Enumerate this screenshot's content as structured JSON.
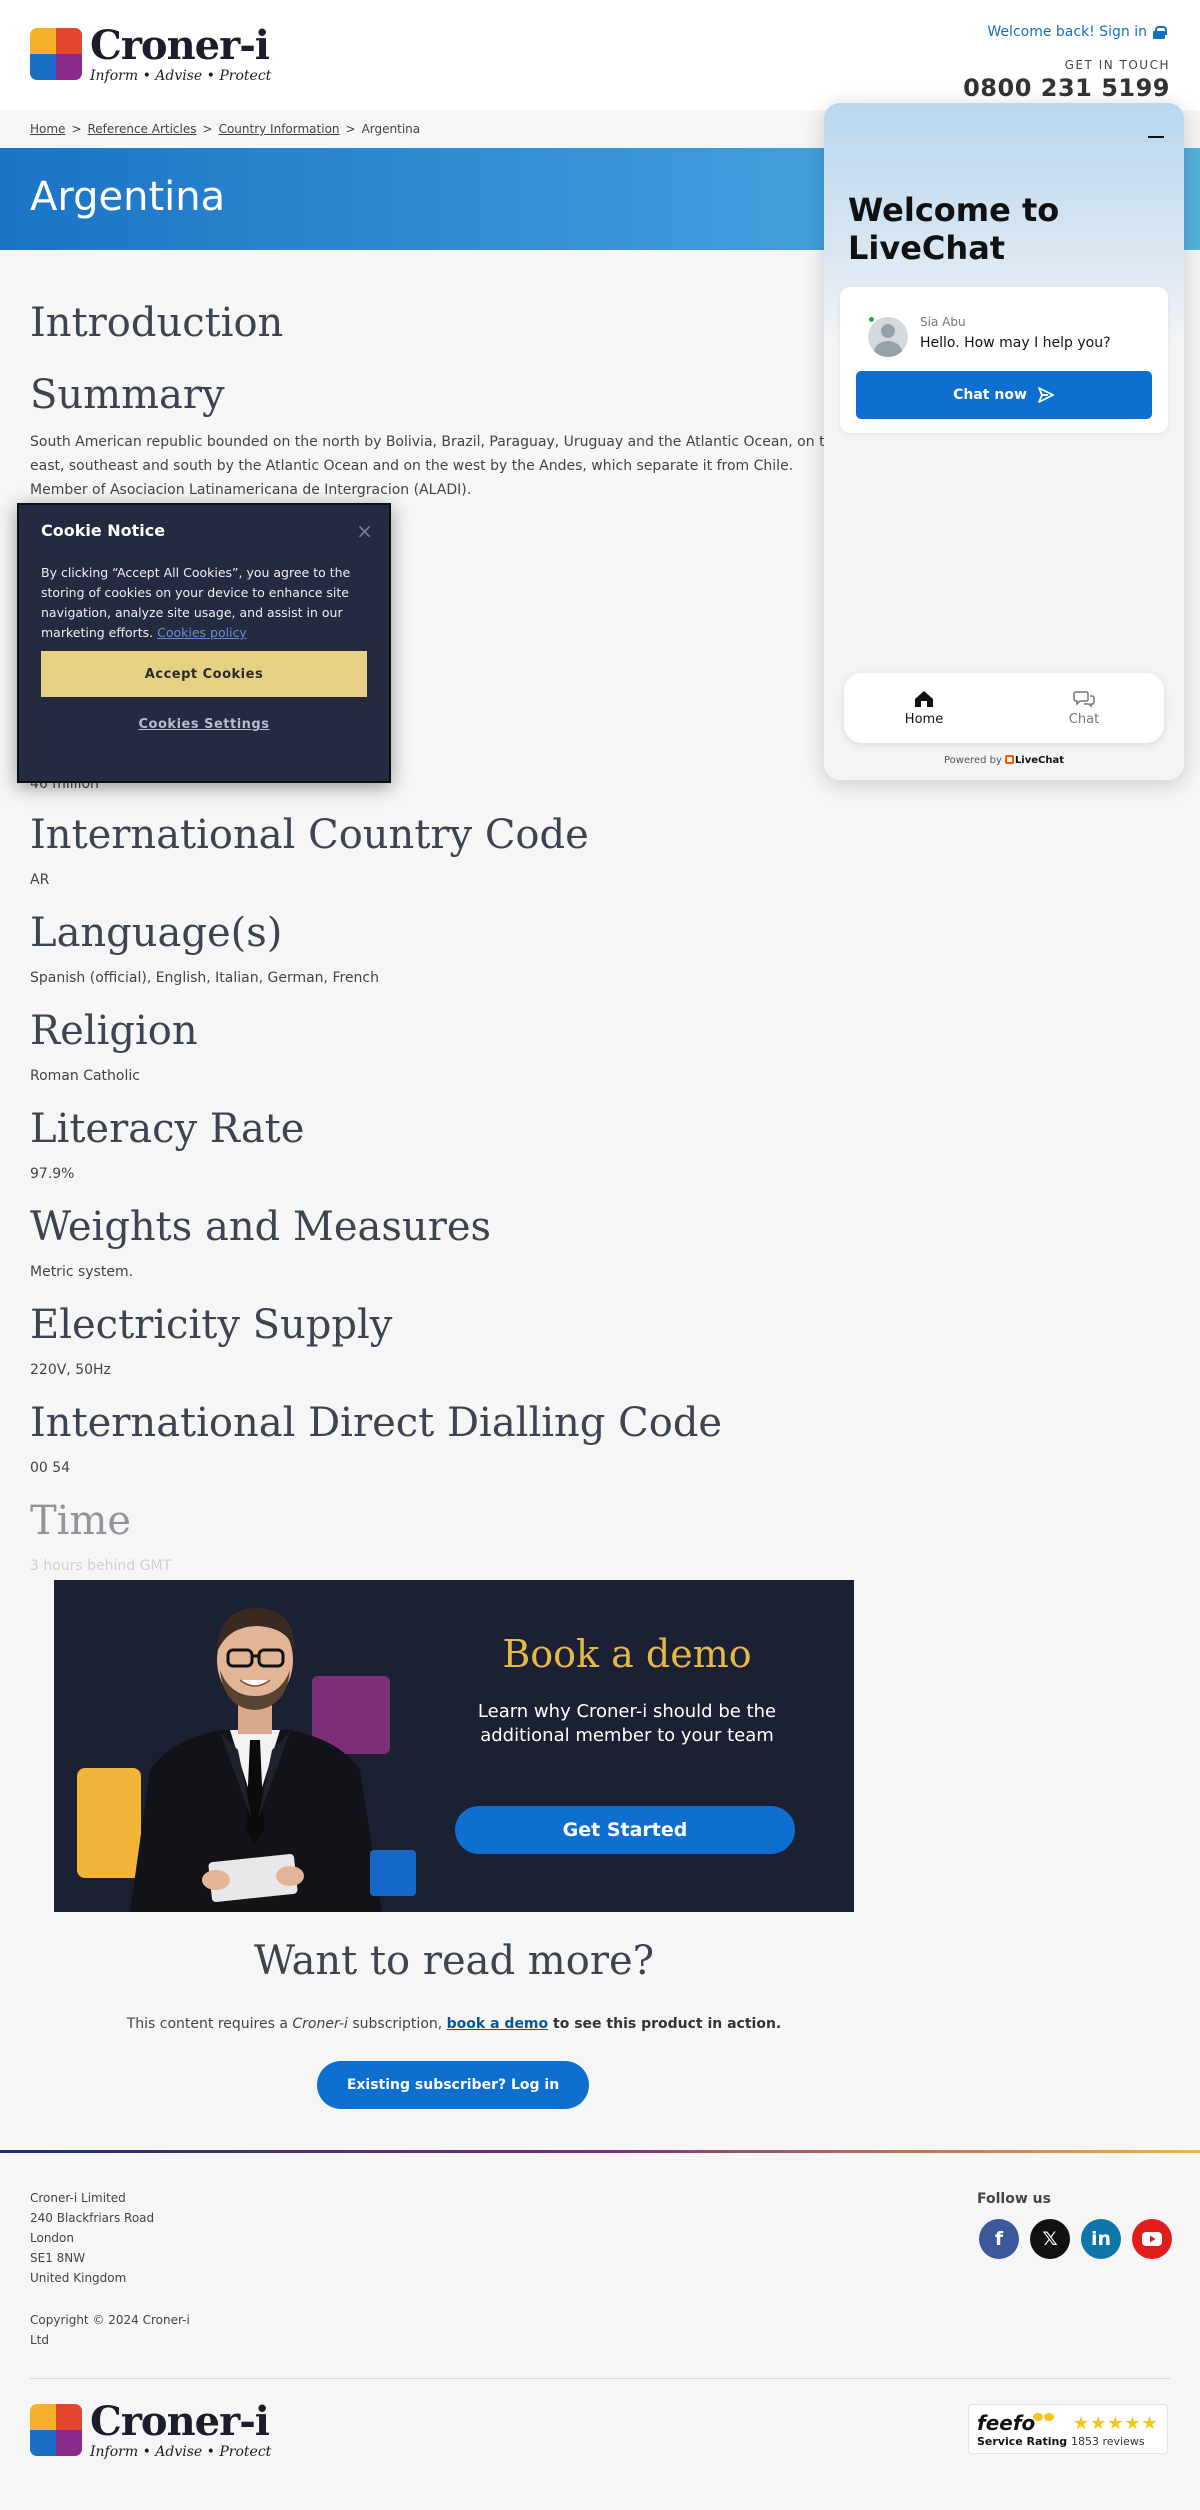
{
  "header": {
    "logo_name": "Croner-i",
    "logo_tagline": "Inform • Advise • Protect",
    "signin": "Welcome back! Sign in",
    "get_in_touch": "GET IN TOUCH",
    "phone": "0800 231 5199"
  },
  "breadcrumb": {
    "items": [
      "Home",
      "Reference Articles",
      "Country Information"
    ],
    "current": "Argentina",
    "separator": ">"
  },
  "page_title": "Argentina",
  "sections": {
    "introduction": "Introduction",
    "summary_heading": "Summary",
    "summary_text": "South American republic bounded on the north by Bolivia, Brazil, Paraguay, Uruguay and the Atlantic Ocean, on the east, southeast and south by the Atlantic Ocean and on the west by the Andes, which separate it from Chile. Member of Asociacion Latinamericana de Intergracion (ALADI).",
    "population_value": "46 million",
    "country_code_heading": "International Country Code",
    "country_code_value": "AR",
    "language_heading": "Language(s)",
    "language_value": "Spanish (official), English, Italian, German, French",
    "religion_heading": "Religion",
    "religion_value": "Roman Catholic",
    "literacy_heading": "Literacy Rate",
    "literacy_value": "97.9%",
    "weights_heading": "Weights and Measures",
    "weights_value": "Metric system.",
    "electricity_heading": "Electricity Supply",
    "electricity_value": "220V, 50Hz",
    "idd_heading": "International Direct Dialling Code",
    "idd_value": "00 54",
    "time_heading": "Time",
    "time_value": "3 hours behind GMT"
  },
  "cookie": {
    "title": "Cookie Notice",
    "close": "×",
    "body": "By clicking “Accept All Cookies”, you agree to the storing of cookies on your device to enhance site navigation, analyze site usage, and assist in our marketing efforts.",
    "policy_link": "Cookies policy",
    "accept": "Accept Cookies",
    "settings": "Cookies Settings"
  },
  "livechat": {
    "title": "Welcome to LiveChat",
    "agent_name": "Sia Abu",
    "message": "Hello. How may I help you?",
    "chat_now": "Chat now",
    "tab_home": "Home",
    "tab_chat": "Chat",
    "powered_by": "Powered by",
    "brand": "LiveChat"
  },
  "demo": {
    "title": "Book a demo",
    "subtitle": "Learn why Croner-i should be the additional member to your team",
    "button": "Get Started"
  },
  "read_more": {
    "title": "Want to read more?",
    "text_before": "This content requires a ",
    "product": "Croner-i",
    "text_middle": " subscription, ",
    "link": "book a demo",
    "text_after": " to see this product in action.",
    "button": "Existing subscriber? Log in"
  },
  "footer": {
    "company": "Croner-i Limited",
    "address_line1": "240 Blackfriars Road",
    "address_line2": "London",
    "address_line3": "SE1 8NW",
    "address_line4": "United Kingdom",
    "copyright": "Copyright © 2024 Croner-i Ltd",
    "follow_us": "Follow us",
    "feefo_name": "feefo",
    "feefo_service": "Service Rating",
    "feefo_stars": "★★★★★",
    "feefo_reviews": "1853 reviews"
  },
  "colors": {
    "accent": "#0f6fd1",
    "hero_start": "#1b74c5",
    "hero_end": "#55b2df",
    "demo_bg": "#1c2033",
    "demo_title": "#e5b84a",
    "cookie_bg": "#242a3f",
    "cookie_accept": "#e6d083"
  }
}
